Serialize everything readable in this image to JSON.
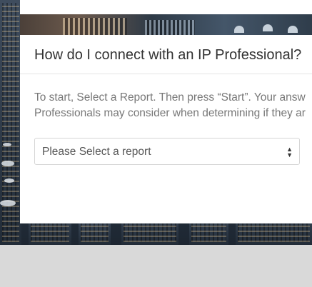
{
  "modal": {
    "title": "How do I connect with an IP Professional?",
    "instructions_line1": "To start, Select a Report. Then press “Start”. Your answ",
    "instructions_line2": "Professionals may consider when determining if they ar",
    "report_select": {
      "selected": "Please Select a report",
      "caret_up": "▲",
      "caret_down": "▼"
    }
  }
}
